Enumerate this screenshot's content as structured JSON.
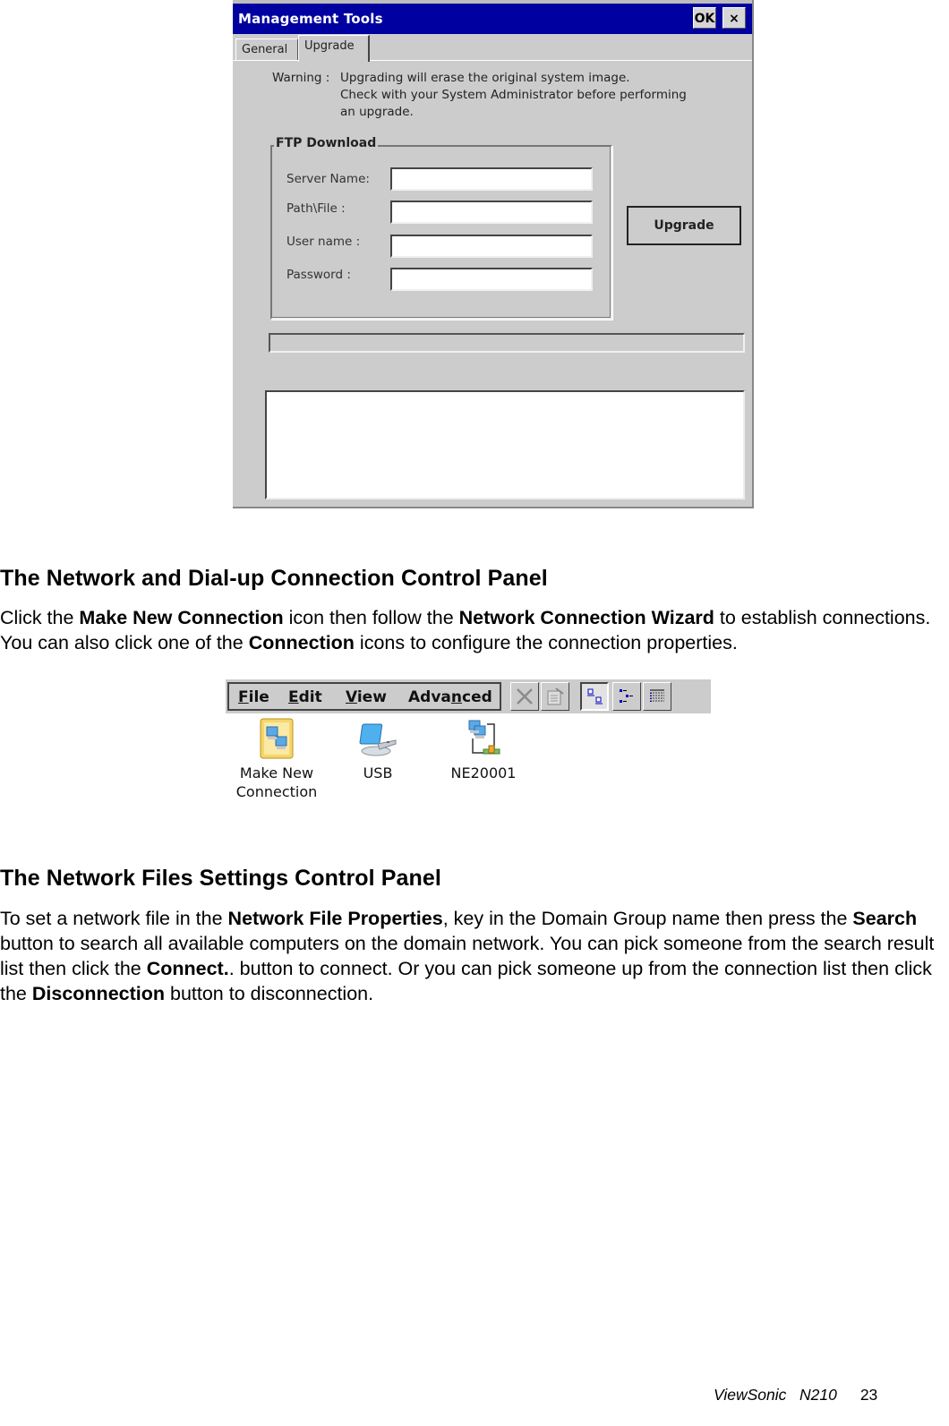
{
  "management_dialog": {
    "title": "Management Tools",
    "ok_label": "OK",
    "close_label": "×",
    "tabs": [
      {
        "label": "General",
        "active": false
      },
      {
        "label": "Upgrade",
        "active": true
      }
    ],
    "warning_label": "Warning :",
    "warning_lines": [
      "Upgrading will erase the original system image.",
      "Check with your System Administrator before performing",
      "an upgrade."
    ],
    "group_title": "FTP Download",
    "fields": [
      {
        "label": "Server Name:",
        "value": ""
      },
      {
        "label": "Path\\File :",
        "value": ""
      },
      {
        "label": "User name :",
        "value": ""
      },
      {
        "label": "Password :",
        "value": ""
      }
    ],
    "upgrade_button": "Upgrade",
    "progress": 0,
    "log_text": ""
  },
  "section1": {
    "heading": "The Network and Dial-up Connection Control Panel",
    "paragraph": [
      {
        "t": "Click the ",
        "b": false
      },
      {
        "t": "Make New Connection",
        "b": true
      },
      {
        "t": " icon then follow the ",
        "b": false
      },
      {
        "t": "Network Connection Wizard",
        "b": true
      },
      {
        "t": " to establish connections. You can also click one of the ",
        "b": false
      },
      {
        "t": "Connection",
        "b": true
      },
      {
        "t": " icons to configure the connection properties.",
        "b": false
      }
    ]
  },
  "network_window": {
    "menus": [
      {
        "label": "File",
        "accel": "F"
      },
      {
        "label": "Edit",
        "accel": "E"
      },
      {
        "label": "View",
        "accel": "V"
      },
      {
        "label": "Advanced",
        "accel": "n"
      }
    ],
    "toolbar_buttons": [
      "delete-icon",
      "properties-icon",
      "large-icons-view-icon",
      "small-icons-view-icon",
      "details-view-icon"
    ],
    "items": [
      {
        "label_line1": "Make New",
        "label_line2": "Connection",
        "icon": "make-new-connection-icon"
      },
      {
        "label_line1": "USB",
        "label_line2": "",
        "icon": "usb-connection-icon"
      },
      {
        "label_line1": "NE20001",
        "label_line2": "",
        "icon": "network-connection-icon"
      }
    ]
  },
  "section2": {
    "heading": "The Network Files Settings Control Panel",
    "paragraph": [
      {
        "t": "To set a network file in the ",
        "b": false
      },
      {
        "t": "Network File Properties",
        "b": true
      },
      {
        "t": ", key in the Domain Group name then press the ",
        "b": false
      },
      {
        "t": "Search",
        "b": true
      },
      {
        "t": " button to search all available computers on the domain network. You can pick someone from the search result list then click the ",
        "b": false
      },
      {
        "t": "Connect.",
        "b": true
      },
      {
        "t": ". button to connect. Or you can pick someone up from the connection list then click the ",
        "b": false
      },
      {
        "t": "Disconnection",
        "b": true
      },
      {
        "t": " button to disconnection.",
        "b": false
      }
    ]
  },
  "footer": {
    "brand": "ViewSonic",
    "model": "N210",
    "page": "23"
  }
}
